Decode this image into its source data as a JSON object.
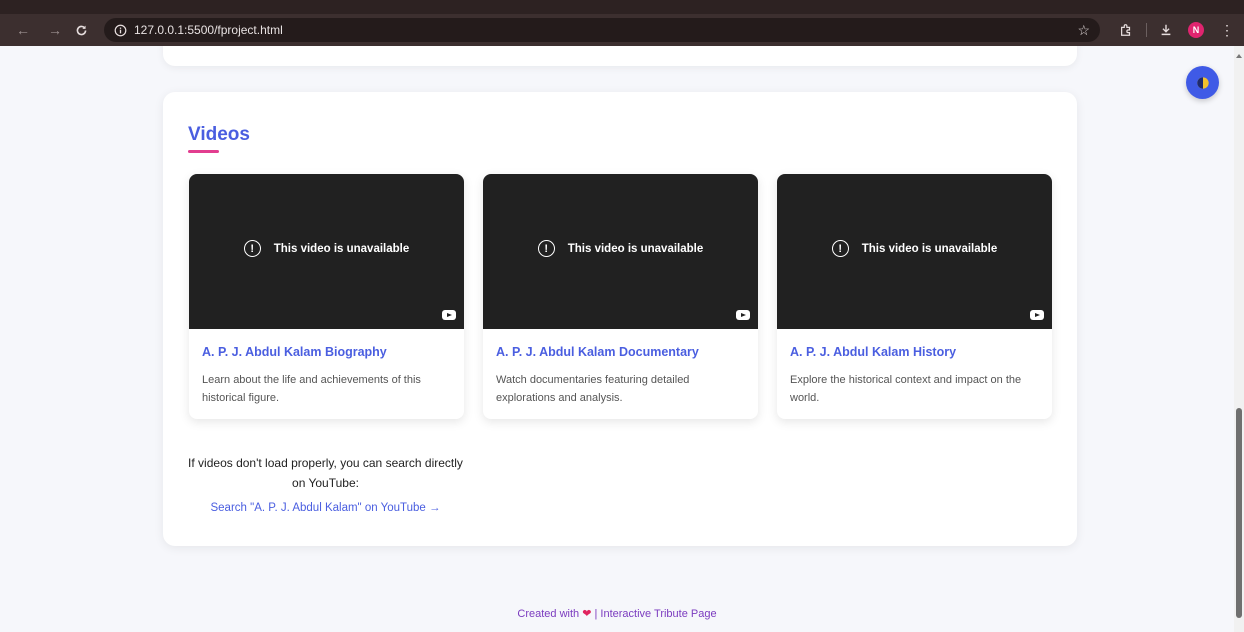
{
  "browser": {
    "url": "127.0.0.1:5500/fproject.html",
    "profile_initial": "N",
    "icons": {
      "back": "arrow-left-icon",
      "forward": "arrow-right-icon",
      "reload": "reload-icon",
      "site_info": "info-icon",
      "bookmark": "star-icon",
      "extensions": "puzzle-icon",
      "downloads": "download-icon",
      "menu": "kebab-menu-icon"
    }
  },
  "videos_section": {
    "title": "Videos",
    "unavailable_text": "This video is unavailable",
    "items": [
      {
        "title": "A. P. J. Abdul Kalam Biography",
        "description": "Learn about the life and achievements of this historical figure."
      },
      {
        "title": "A. P. J. Abdul Kalam Documentary",
        "description": "Watch documentaries featuring detailed explorations and analysis."
      },
      {
        "title": "A. P. J. Abdul Kalam History",
        "description": "Explore the historical context and impact on the world."
      }
    ],
    "fallback_text": "If videos don't load properly, you can search directly on YouTube:",
    "fallback_link": "Search \"A. P. J. Abdul Kalam\" on YouTube →"
  },
  "footer": {
    "prefix": "Created with",
    "suffix": "| Interactive Tribute Page"
  },
  "colors": {
    "accent": "#4a5ee0",
    "underline": "#e23d8f",
    "footer_text": "#7b3bbf",
    "heart": "#e0245e",
    "video_bg": "#212121"
  }
}
